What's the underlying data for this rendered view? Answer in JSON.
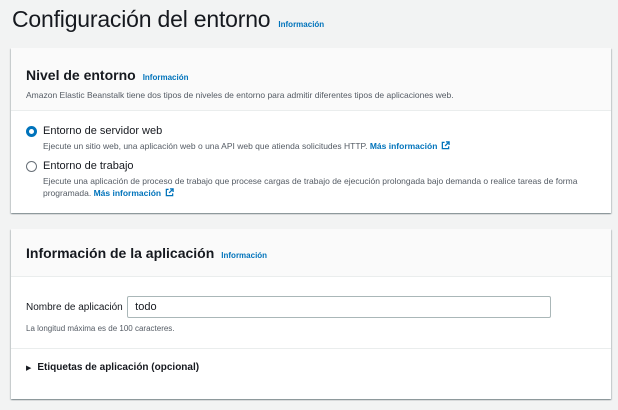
{
  "page": {
    "title": "Configuración del entorno",
    "info_link": "Información"
  },
  "tier_panel": {
    "title": "Nivel de entorno",
    "info_link": "Información",
    "description": "Amazon Elastic Beanstalk tiene dos tipos de niveles de entorno para admitir diferentes tipos de aplicaciones web.",
    "options": [
      {
        "label": "Entorno de servidor web",
        "description": "Ejecute un sitio web, una aplicación web o una API web que atienda solicitudes HTTP.",
        "link": "Más información",
        "selected": true
      },
      {
        "label": "Entorno de trabajo",
        "description": "Ejecute una aplicación de proceso de trabajo que procese cargas de trabajo de ejecución prolongada bajo demanda o realice tareas de forma programada.",
        "link": "Más información",
        "selected": false
      }
    ]
  },
  "app_panel": {
    "title": "Información de la aplicación",
    "info_link": "Información",
    "name_label": "Nombre de aplicación",
    "name_value": "todo",
    "name_hint": "La longitud máxima es de 100 caracteres.",
    "tags_label": "Etiquetas de aplicación (opcional)"
  },
  "colors": {
    "accent": "#0073bb",
    "background": "#f2f3f3",
    "text": "#16191f",
    "secondary_text": "#545b64"
  },
  "icons": {
    "external_link": "external-link-icon",
    "expand": "caret-right-icon"
  }
}
